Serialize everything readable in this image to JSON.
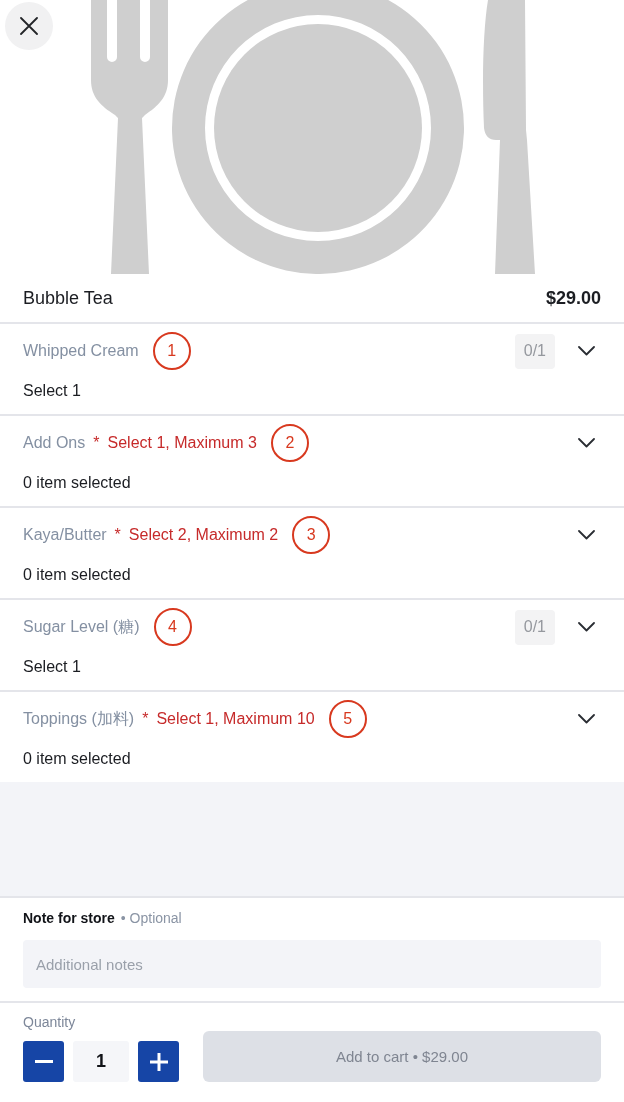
{
  "item": {
    "name": "Bubble Tea",
    "price": "$29.00"
  },
  "option_groups": [
    {
      "title": "Whipped Cream",
      "callout": "1",
      "counter": "0/1",
      "status": "Select 1",
      "expanded": false
    },
    {
      "title": "Add Ons",
      "required_mark": "*",
      "requirement": "Select 1, Maximum 3",
      "callout": "2",
      "status": "0 item selected",
      "expanded": false
    },
    {
      "title": "Kaya/Butter",
      "required_mark": "*",
      "requirement": "Select 2, Maximum 2",
      "callout": "3",
      "status": "0 item selected",
      "expanded": false
    },
    {
      "title": "Sugar Level (糖)",
      "callout": "4",
      "counter": "0/1",
      "status": "Select 1",
      "expanded": false
    },
    {
      "title": "Toppings (加料)",
      "required_mark": "*",
      "requirement": "Select 1, Maximum 10",
      "callout": "5",
      "status": "0 item selected",
      "expanded": false
    }
  ],
  "note": {
    "label": "Note for store",
    "hint": "• Optional",
    "placeholder": "Additional notes"
  },
  "quantity": {
    "label": "Quantity",
    "value": "1"
  },
  "add_to_cart": {
    "label": "Add to cart • $29.00",
    "disabled": true
  }
}
